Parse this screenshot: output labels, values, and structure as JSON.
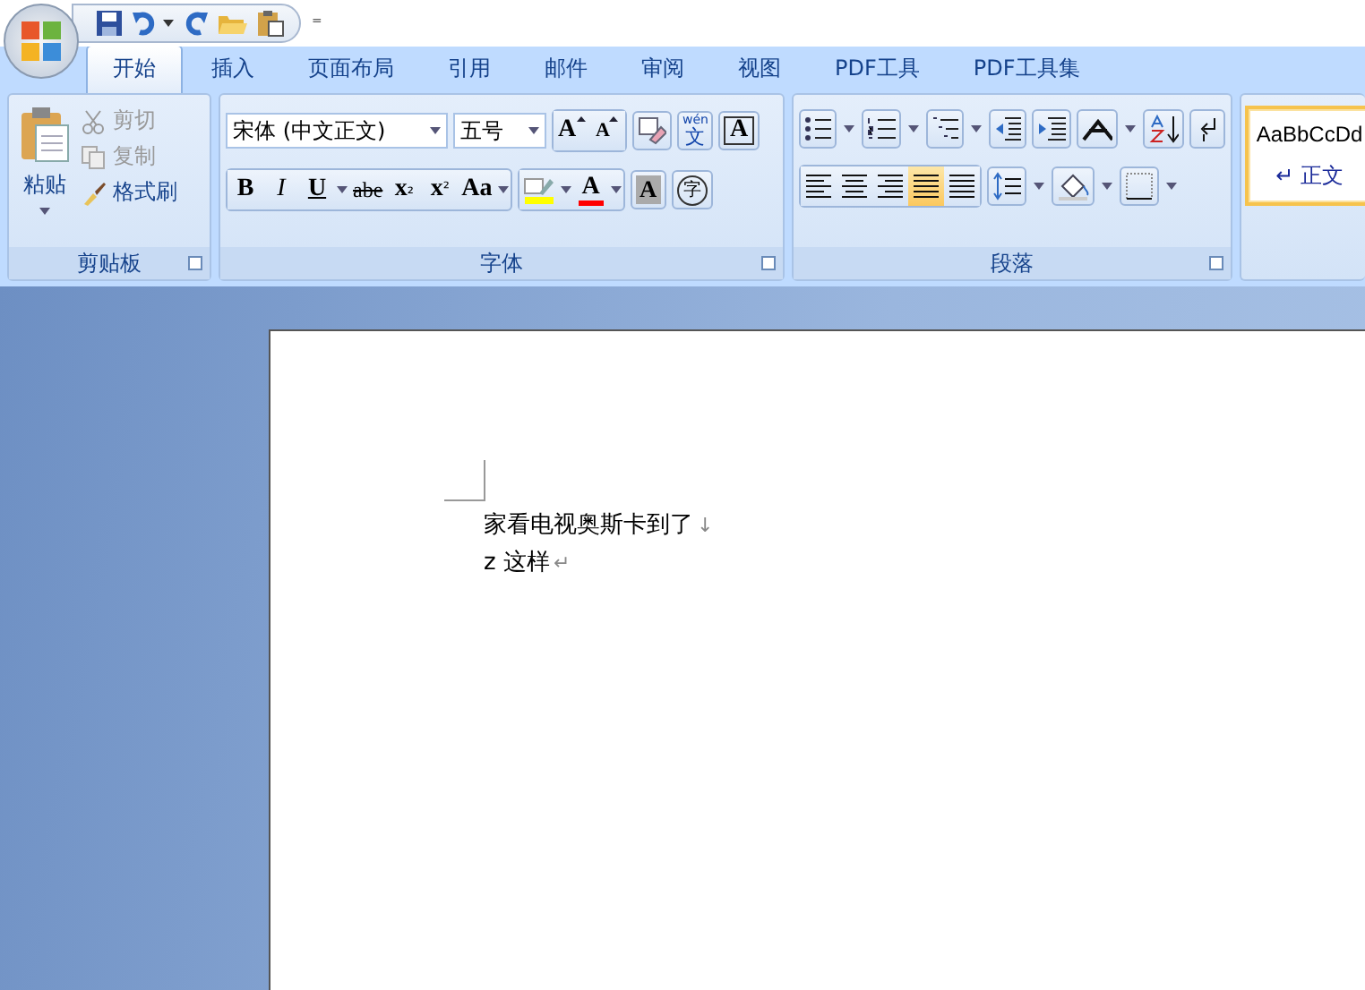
{
  "quick_access": {
    "tools": [
      {
        "kind": "save"
      },
      {
        "kind": "undo",
        "dropdown": true
      },
      {
        "kind": "redo"
      },
      {
        "kind": "open"
      },
      {
        "kind": "paste"
      }
    ],
    "customize": "⁼"
  },
  "tabs": [
    {
      "label": "开始",
      "selected": true
    },
    {
      "label": "插入",
      "selected": false
    },
    {
      "label": "页面布局",
      "selected": false
    },
    {
      "label": "引用",
      "selected": false
    },
    {
      "label": "邮件",
      "selected": false
    },
    {
      "label": "审阅",
      "selected": false
    },
    {
      "label": "视图",
      "selected": false
    },
    {
      "label": "PDF工具",
      "selected": false
    },
    {
      "label": "PDF工具集",
      "selected": false
    }
  ],
  "clipboard": {
    "title": "剪贴板",
    "paste": "粘贴",
    "actions": [
      {
        "kind": "cut",
        "label": "剪切",
        "disabled": true
      },
      {
        "kind": "copy",
        "label": "复制",
        "disabled": true
      },
      {
        "kind": "brush",
        "label": "格式刷",
        "disabled": false
      }
    ]
  },
  "font": {
    "title": "字体",
    "font_name": "宋体 (中文正文)",
    "font_size": "五号",
    "row1": [
      {
        "kind": "grow",
        "label": "A"
      },
      {
        "kind": "shrink",
        "label": "A"
      },
      {
        "kind": "clear"
      },
      {
        "kind": "phonetic",
        "label": "文",
        "top": "wén"
      },
      {
        "kind": "border",
        "label": "A"
      }
    ],
    "row2": [
      {
        "kind": "bold",
        "label": "B"
      },
      {
        "kind": "italic",
        "label": "I"
      },
      {
        "kind": "underline",
        "label": "U",
        "dropdown": true
      },
      {
        "kind": "strike",
        "label": "abe"
      },
      {
        "kind": "sub",
        "label": "x",
        "small": "₂"
      },
      {
        "kind": "super",
        "label": "x",
        "small": "²"
      },
      {
        "kind": "case",
        "label": "Aa",
        "dropdown": true
      },
      {
        "kind": "highlight",
        "dropdown": true,
        "color": "#ffff00"
      },
      {
        "kind": "fontcolor",
        "label": "A",
        "dropdown": true,
        "color": "#ff0000"
      },
      {
        "kind": "shade",
        "label": "A"
      },
      {
        "kind": "enclose",
        "label": "字"
      }
    ]
  },
  "paragraph": {
    "title": "段落",
    "row1": [
      {
        "kind": "bullets",
        "dropdown": true
      },
      {
        "kind": "numbering",
        "dropdown": true
      },
      {
        "kind": "multilevel",
        "dropdown": true
      },
      {
        "kind": "outdent"
      },
      {
        "kind": "indent"
      },
      {
        "kind": "layout",
        "dropdown": true
      },
      {
        "kind": "sort"
      },
      {
        "kind": "marks"
      }
    ],
    "align": [
      {
        "kind": "left",
        "selected": false
      },
      {
        "kind": "center",
        "selected": false
      },
      {
        "kind": "right",
        "selected": false
      },
      {
        "kind": "justify",
        "selected": true
      },
      {
        "kind": "distribute",
        "selected": false
      }
    ],
    "row2": [
      {
        "kind": "spacing",
        "dropdown": true
      },
      {
        "kind": "fill",
        "dropdown": true
      },
      {
        "kind": "borders",
        "dropdown": true
      }
    ]
  },
  "styles": [
    {
      "sample": "AaBbCcDd",
      "name": "↵ 正文",
      "selected": true
    }
  ],
  "document": {
    "lines": [
      {
        "text": "家看电视奥斯卡到了",
        "mark": "↓"
      },
      {
        "text": "z 这样",
        "mark": "↵"
      }
    ]
  }
}
